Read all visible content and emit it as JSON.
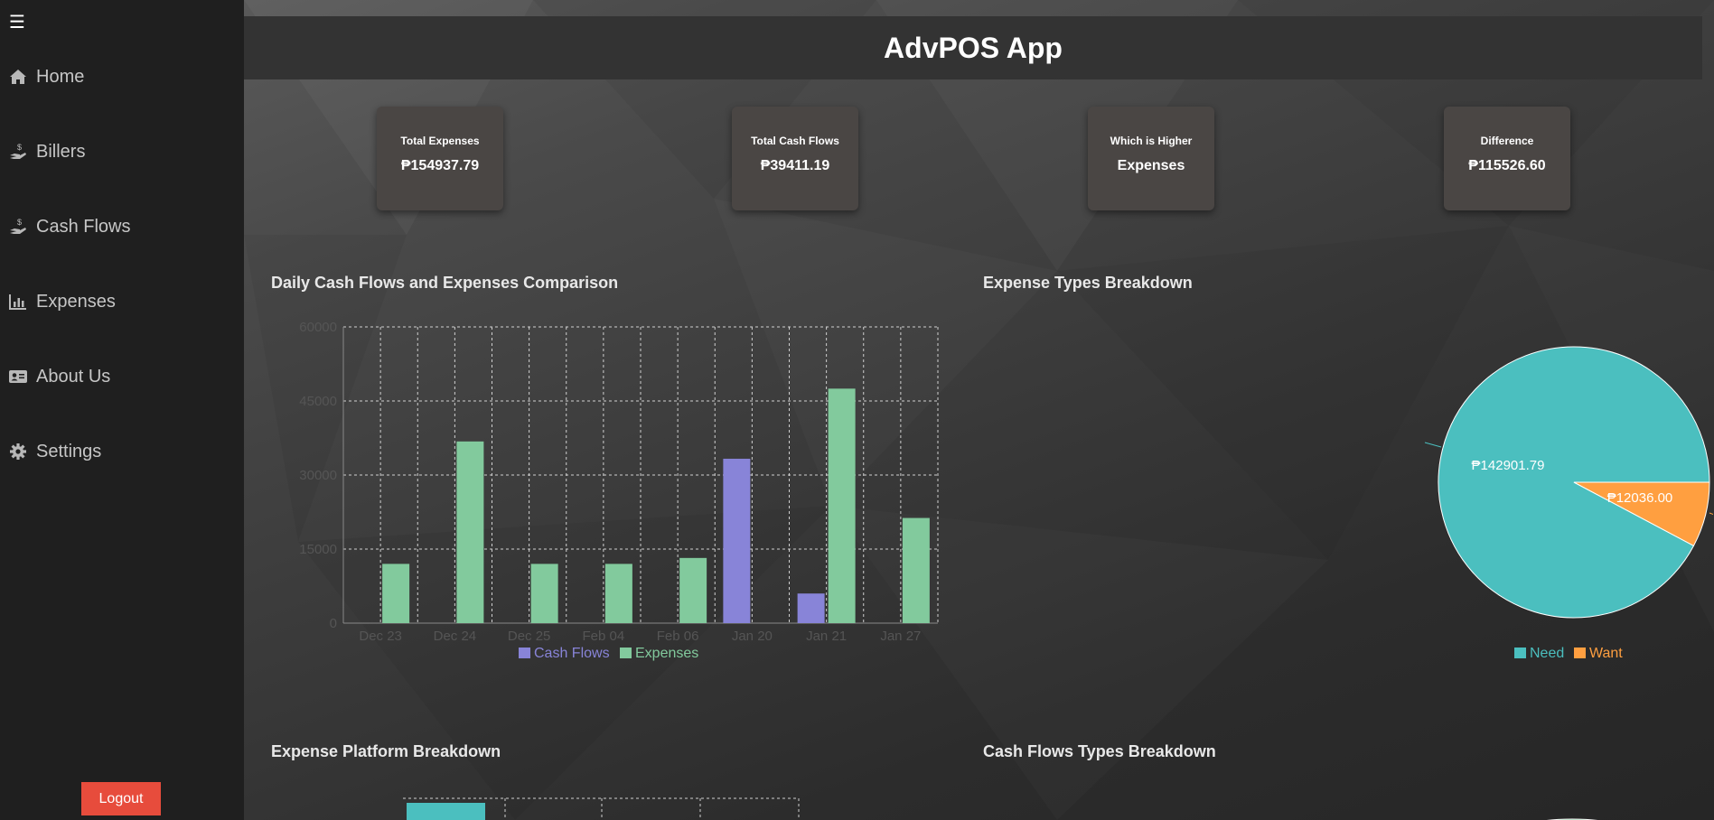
{
  "app": {
    "title": "AdvPOS App"
  },
  "sidebar": {
    "menu_icon": "menu-icon",
    "items": [
      {
        "label": "Home",
        "icon": "home-icon"
      },
      {
        "label": "Billers",
        "icon": "hand-money-icon"
      },
      {
        "label": "Cash Flows",
        "icon": "hand-money-icon"
      },
      {
        "label": "Expenses",
        "icon": "bar-chart-icon"
      },
      {
        "label": "About Us",
        "icon": "id-card-icon"
      },
      {
        "label": "Settings",
        "icon": "gear-icon"
      }
    ],
    "logout_label": "Logout"
  },
  "summary": [
    {
      "title": "Total Expenses",
      "value": "₱154937.79"
    },
    {
      "title": "Total Cash Flows",
      "value": "₱39411.19"
    },
    {
      "title": "Which is Higher",
      "value": "Expenses"
    },
    {
      "title": "Difference",
      "value": "₱115526.60"
    }
  ],
  "sections": {
    "daily": "Daily Cash Flows and Expenses Comparison",
    "expense_types": "Expense Types Breakdown",
    "expense_platform": "Expense Platform Breakdown",
    "cashflow_types": "Cash Flows Types Breakdown"
  },
  "colors": {
    "cash_flows": "#8884d8",
    "expenses": "#82ca9d",
    "need": "#4bbfbf",
    "want": "#ff9f40",
    "logout": "#e74c3c"
  },
  "chart_data": [
    {
      "type": "bar",
      "title": "Daily Cash Flows and Expenses Comparison",
      "categories": [
        "Dec 23",
        "Dec 24",
        "Dec 25",
        "Feb 04",
        "Feb 06",
        "Jan 20",
        "Jan 21",
        "Jan 27"
      ],
      "series": [
        {
          "name": "Cash Flows",
          "values": [
            0,
            0,
            0,
            0,
            0,
            33300,
            6000,
            0
          ]
        },
        {
          "name": "Expenses",
          "values": [
            12000,
            36800,
            12000,
            12000,
            13200,
            0,
            47500,
            21300
          ]
        }
      ],
      "yticks": [
        "0",
        "15000",
        "30000",
        "45000",
        "60000"
      ],
      "ylim": [
        0,
        60000
      ],
      "grid": true,
      "legend": "bottom"
    },
    {
      "type": "pie",
      "title": "Expense Types Breakdown",
      "slices": [
        {
          "name": "Need",
          "value": 142901.79,
          "label": "₱142901.79"
        },
        {
          "name": "Want",
          "value": 12036.0,
          "label": "₱12036.00"
        }
      ],
      "legend": "bottom"
    }
  ]
}
